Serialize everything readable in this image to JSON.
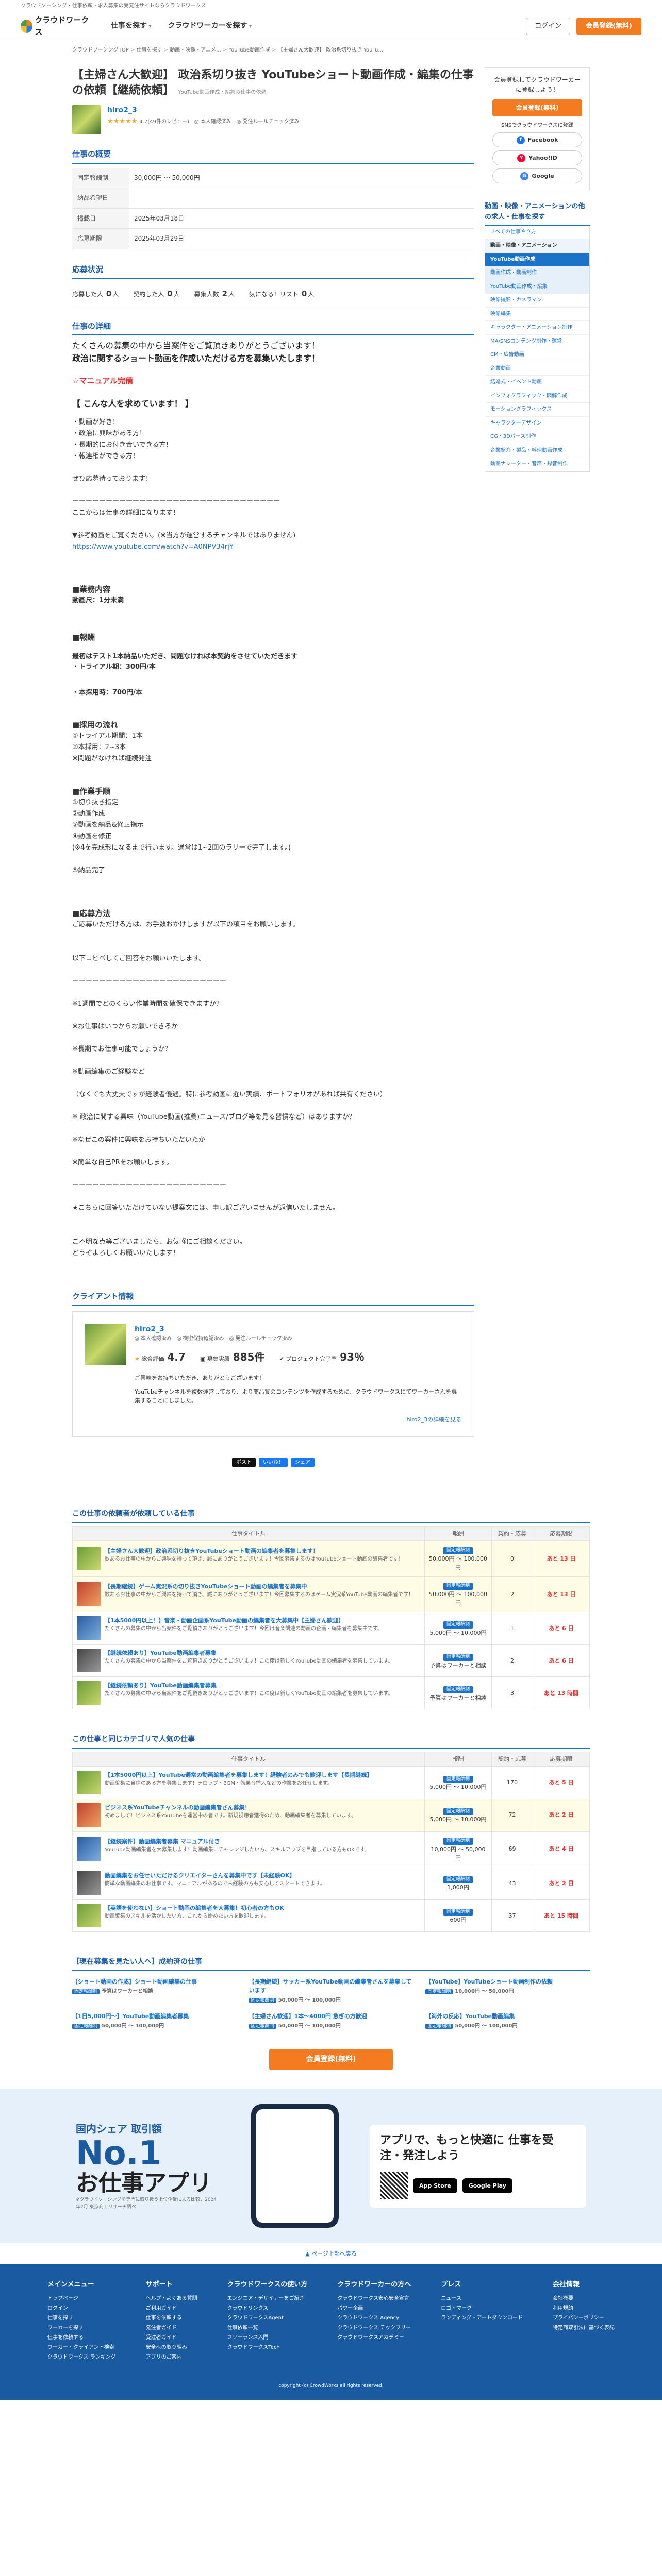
{
  "tagline": "クラウドソーシング・仕事依頼・求人募集の受発注サイトならクラウドワークス",
  "header": {
    "logo_text": "クラウドワークス",
    "nav": [
      "仕事を探す",
      "クラウドワーカーを探す"
    ],
    "login": "ログイン",
    "signup": "会員登録(無料)"
  },
  "breadcrumb": [
    "クラウドソーシングTOP",
    "仕事を探す",
    "動画・映像・アニメ...",
    "YouTube動画作成",
    "【主婦さん大歓迎】 政治系切り抜き YouTu..."
  ],
  "job": {
    "title": "【主婦さん大歓迎】 政治系切り抜き YouTubeショート動画作成・編集の仕事の依頼【継続依頼】",
    "category": "YouTube動画作成・編集の仕事の依頼",
    "client_name": "hiro2_3",
    "rating": "★★★★★",
    "client_meta": "4.7(49件のレビュー)　◎ 本人確認済み　◎ 発注ルールチェック済み"
  },
  "summary": {
    "heading": "仕事の概要",
    "rows": [
      {
        "label": "固定報酬制",
        "value": "30,000円 〜 50,000円"
      },
      {
        "label": "納品希望日",
        "value": "-"
      },
      {
        "label": "掲載日",
        "value": "2025年03月18日"
      },
      {
        "label": "応募期限",
        "value": "2025年03月29日"
      }
    ]
  },
  "status": {
    "heading": "応募状況",
    "items": [
      {
        "label": "応募した人",
        "value": "0",
        "unit": "人"
      },
      {
        "label": "契約した人",
        "value": "0",
        "unit": "人"
      },
      {
        "label": "募集人数",
        "value": "2",
        "unit": "人"
      },
      {
        "label": "気になる！リスト",
        "value": "0",
        "unit": "人"
      }
    ]
  },
  "detail": {
    "heading": "仕事の詳細",
    "intro1": "たくさんの募集の中から当案件をご覧頂きありがとうございます！",
    "intro2": "政治に関するショート動画を作成いただける方を募集いたします！",
    "manual": "☆マニュアル完備",
    "wanted": "【 こんな人を求めています！ 】",
    "lines1": [
      "・動画が好き！",
      "・政治に興味がある方！",
      "・長期的にお付き合いできる方！",
      "・報連相ができる方！",
      "",
      "ぜひ応募待っております！",
      "",
      "ーーーーーーーーーーーーーーーーーーーーーーーーーーーーーーー",
      "ここからは仕事の詳細になります！",
      "",
      "▼参考動画をご覧ください。(※当方が運営するチャンネルではありません)"
    ],
    "link": "https://www.youtube.com/watch?v=A0NPV34rjY",
    "h_content": "■業務内容",
    "content": "動画尺：1分未満",
    "h_pay": "■報酬",
    "pay1": "最初はテスト1本納品いただき、問題なければ本契約をさせていただきます",
    "pay2": "・トライアル期：300円/本",
    "pay3": "・本採用時：700円/本",
    "h_flow": "■採用の流れ",
    "flow": [
      "①トライアル期間：1本",
      "②本採用：2~3本",
      "※問題がなければ継続発注"
    ],
    "h_work": "■作業手順",
    "work": [
      "①切り抜き指定",
      "②動画作成",
      "③動画を納品&修正指示",
      "④動画を修正",
      "(※4を完成形になるまで行います。通常は1~2回のラリーで完了します。)",
      "",
      "⑤納品完了"
    ],
    "h_apply": "■応募方法",
    "apply": [
      "ご応募いただける方は、お手数おかけしますが以下の項目をお願いします。",
      "",
      "",
      "以下コピペしてご回答をお願いいたします。",
      "",
      "ーーーーーーーーーーーーーーーーーーーーーーー",
      "",
      "※1週間でどのくらい作業時間を確保できますか？",
      "",
      "※お仕事はいつからお願いできるか",
      "",
      "※長期でお仕事可能でしょうか？",
      "",
      "※動画編集のご経験など",
      "",
      "（なくても大丈夫ですが経験者優遇。特に参考動画に近い実績、ポートフォリオがあれば共有ください）",
      "",
      "※ 政治に関する興味（YouTube動画(推薦)ニュース/ブログ等を見る習慣など）はありますか？",
      "",
      "※なぜこの案件に興味をお持ちいただいたか",
      "",
      "※簡単な自己PRをお願いします。",
      "",
      "ーーーーーーーーーーーーーーーーーーーーーーー",
      "",
      "★こちらに回答いただけていない提案文には、申し訳ございませんが返信いたしません。",
      "",
      "",
      "ご不明な点等ございましたら、お気軽にご相談ください。",
      "どうぞよろしくお願いいたします！"
    ]
  },
  "client_box": {
    "heading": "クライアント情報",
    "name": "hiro2_3",
    "badges": "◎ 本人確認済み　◎ 機密保持確認済み　◎ 発注ルールチェック済み",
    "rating_label": "総合評価",
    "rating": "4.7",
    "rate_label": "募集実績",
    "rate": "885件",
    "done_label": "プロジェクト完了率",
    "done": "93％",
    "msg1": "ご興味をお持ちいただき、ありがとうございます！",
    "msg2": "YouTubeチャンネルを複数運営しており、より高品質のコンテンツを作成するために、クラウドワークスにてワーカーさんを募集することにしました。",
    "more": "hiro2_3の詳細を見る"
  },
  "share": [
    "ポスト",
    "いいね！",
    "シェア"
  ],
  "sidebar": {
    "prompt": "会員登録してクラウドワーカーに登録しよう！",
    "signup": "会員登録(無料)",
    "sns_label": "SNSでクラウドワークスに登録",
    "sns": [
      "Facebook",
      "Yahoo!ID",
      "Google"
    ],
    "cat_heading": "動画・映像・アニメーションの他の求人・仕事を探す",
    "cats": [
      {
        "label": "すべての仕事やり方",
        "type": "link"
      },
      {
        "label": "動画・映像・アニメーション",
        "type": "parent"
      },
      {
        "label": "YouTube動画作成",
        "type": "active"
      },
      {
        "label": "動画作成・動画制作",
        "type": "child"
      },
      {
        "label": "YouTube動画作成・編集",
        "type": "child"
      },
      {
        "label": "映像撮影・カメラマン",
        "type": "link"
      },
      {
        "label": "映像編集",
        "type": "link"
      },
      {
        "label": "キャラクター・アニメーション制作",
        "type": "link"
      },
      {
        "label": "MA/SNSコンテンツ制作・運営",
        "type": "link"
      },
      {
        "label": "CM・広告動画",
        "type": "link"
      },
      {
        "label": "企業動画",
        "type": "link"
      },
      {
        "label": "結婚式・イベント動画",
        "type": "link"
      },
      {
        "label": "インフォグラフィック・図解作成",
        "type": "link"
      },
      {
        "label": "モーショングラフィックス",
        "type": "link"
      },
      {
        "label": "キャラクターデザイン",
        "type": "link"
      },
      {
        "label": "CG・3Dパース制作",
        "type": "link"
      },
      {
        "label": "企業紹介・製品・料理動画作成",
        "type": "link"
      },
      {
        "label": "動画ナレーター・音声・録音制作",
        "type": "link"
      }
    ]
  },
  "related1": {
    "heading": "この仕事の依頼者が依頼している仕事",
    "cols": [
      "仕事タイトル",
      "報酬",
      "契約・応募",
      "応募期限"
    ],
    "rows": [
      {
        "title": "【主婦さん大歓迎】政治系切り抜きYouTubeショート動画の編集者を募集します！",
        "desc": "数あるお仕事の中からご興味を持って頂き、誠にありがとうございます！今回募集するのはYouTubeショート動画の編集者です！",
        "tag": "固定報酬制",
        "price": "50,000円 〜 100,000円",
        "count": "0",
        "deadline": "あと 13 日",
        "yellow": true
      },
      {
        "title": "【長期継続】ゲーム実況系の切り抜きYouTubeショート動画の編集者を募集中",
        "desc": "数あるお仕事の中からご興味を持って頂き、誠にありがとうございます！今回募集するのはゲーム実況系YouTube動画の編集者です！",
        "tag": "固定報酬制",
        "price": "50,000円 〜 100,000円",
        "count": "2",
        "deadline": "あと 13 日",
        "yellow": true
      },
      {
        "title": "【1本5000円以上！】音楽・動画企画系YouTube動画の編集者を大募集中【主婦さん歓迎】",
        "desc": "たくさんの募集の中から当案件をご覧頂きありがとうございます！今回は音楽関連の動画の企画・編集者を募集中です。",
        "tag": "固定報酬制",
        "price": "5,000円 〜 10,000円",
        "count": "1",
        "deadline": "あと 6 日",
        "yellow": false
      },
      {
        "title": "【継続依頼あり】YouTube動画編集者募集",
        "desc": "たくさんの募集の中から当案件をご覧頂きありがとうございます！この度は新しくYouTube動画の編集者を募集しています。",
        "tag": "固定報酬制",
        "price": "予算はワーカーと相談",
        "count": "2",
        "deadline": "あと 6 日",
        "yellow": false
      },
      {
        "title": "【継続依頼あり】YouTube動画編集者募集",
        "desc": "たくさんの募集の中から当案件をご覧頂きありがとうございます！この度は新しくYouTube動画の編集者を募集しています。",
        "tag": "固定報酬制",
        "price": "予算はワーカーと相談",
        "count": "3",
        "deadline": "あと 13 時間",
        "yellow": false
      }
    ]
  },
  "related2": {
    "heading": "この仕事と同じカテゴリで人気の仕事",
    "rows": [
      {
        "title": "【1本5000円以上】YouTube通常の動画編集者を募集します！経験者のみでも歓迎します【長期継続】",
        "desc": "動画編集に自信のある方を募集します！テロップ・BGM・効果音挿入などの作業をお任せします。",
        "tag": "固定報酬制",
        "price": "5,000円 〜 10,000円",
        "count": "170",
        "deadline": "あと 5 日",
        "yellow": false
      },
      {
        "title": "ビジネス系YouTubeチャンネルの動画編集者さん募集！",
        "desc": "初めまして！ビジネス系YouTubeを運営中の者です。新規視聴者獲得のため、動画編集者を募集しています。",
        "tag": "固定報酬制",
        "price": "5,000円 〜 10,000円",
        "count": "72",
        "deadline": "あと 2 日",
        "yellow": true
      },
      {
        "title": "【継続案件】動画編集者募集 マニュアル付き",
        "desc": "YouTube動画編集者を大募集します！動画編集にチャレンジしたい方、スキルアップを目指している方もOKです。",
        "tag": "固定報酬制",
        "price": "10,000円 〜 50,000円",
        "count": "69",
        "deadline": "あと 4 日",
        "yellow": false
      },
      {
        "title": "動画編集をお任せいただけるクリエイターさんを募集中です【未経験OK】",
        "desc": "簡単な動画編集のお仕事です。マニュアルがあるので未経験の方も安心してスタートできます。",
        "tag": "固定報酬制",
        "price": "1,000円",
        "count": "43",
        "deadline": "あと 2 日",
        "yellow": false
      },
      {
        "title": "【英語を使わない】ショート動画の編集者を大募集！初心者の方もOK",
        "desc": "動画編集のスキルを活かしたい方、これから始めたい方を歓迎します。",
        "tag": "固定報酬制",
        "price": "600円",
        "count": "37",
        "deadline": "あと 15 時間",
        "yellow": false
      }
    ]
  },
  "related3": {
    "heading": "【現在募集を見たい人へ】成約済の仕事",
    "items": [
      {
        "title": "【ショート動画の作成】ショート動画編集の仕事",
        "tag": "固定報酬制",
        "price": "予算はワーカーと相談"
      },
      {
        "title": "【長期継続】サッカー系YouTube動画の編集者さんを募集しています",
        "tag": "固定報酬制",
        "price": "50,000円 〜 100,000円"
      },
      {
        "title": "【YouTube】YouTubeショート動画制作の依頼",
        "tag": "固定報酬制",
        "price": "10,000円 〜 50,000円"
      },
      {
        "title": "【1日5,000円〜】YouTube動画編集者募集",
        "tag": "固定報酬制",
        "price": "50,000円 〜 100,000円"
      },
      {
        "title": "【主婦さん歓迎】1本〜4000円 急ぎの方歓迎",
        "tag": "固定報酬制",
        "price": "50,000円 〜 100,000円"
      },
      {
        "title": "【海外の反応】YouTube動画編集",
        "tag": "固定報酬制",
        "price": "50,000円 〜 100,000円"
      }
    ]
  },
  "cta": "会員登録(無料)",
  "app": {
    "small": "国内シェア 取引額",
    "no1": "No.1",
    "big": "お仕事アプリ",
    "note": "※クラウドソーシングを専門に取り扱う上位企業による比較、2024年2月 東京商工リサーチ調べ",
    "right": "アプリで、もっと快適に 仕事を受注・発注しよう",
    "stores": [
      "App Store",
      "Google Play"
    ]
  },
  "pagetop": "ページ上部へ戻る",
  "footer": {
    "cols": [
      {
        "h": "メインメニュー",
        "items": [
          "トップページ",
          "ログイン",
          "仕事を探す",
          "ワーカーを探す",
          "仕事を依頼する",
          "ワーカー・クライアント検索",
          "クラウドワークス ランキング"
        ]
      },
      {
        "h": "サポート",
        "items": [
          "ヘルプ・よくある質問",
          "ご利用ガイド",
          "仕事を依頼する",
          "発注者ガイド",
          "受注者ガイド",
          "安全への取り組み",
          "アプリのご案内"
        ]
      },
      {
        "h": "クラウドワークスの使い方",
        "items": [
          "エンジニア・デザイナーをご紹介",
          "クラウドリンクス",
          "クラウドワークスAgent",
          "仕事依頼一覧",
          "フリーランス入門",
          "クラウドワークスTech"
        ]
      },
      {
        "h": "クラウドワーカーの方へ",
        "items": [
          "クラウドワークス安心安全宣言",
          "パワー企画",
          "クラウドワークス Agency",
          "クラウドワークス テックフリー",
          "クラウドワークスアカデミー"
        ]
      },
      {
        "h": "プレス",
        "items": [
          "ニュース",
          "ロゴ・マーク",
          "ランディング・アートダウンロード"
        ]
      },
      {
        "h": "会社情報",
        "items": [
          "会社概要",
          "利用規約",
          "プライバシーポリシー",
          "特定商取引法に基づく表記"
        ]
      }
    ],
    "copy": "copyright (c) CrowdWorks all rights reserved."
  }
}
